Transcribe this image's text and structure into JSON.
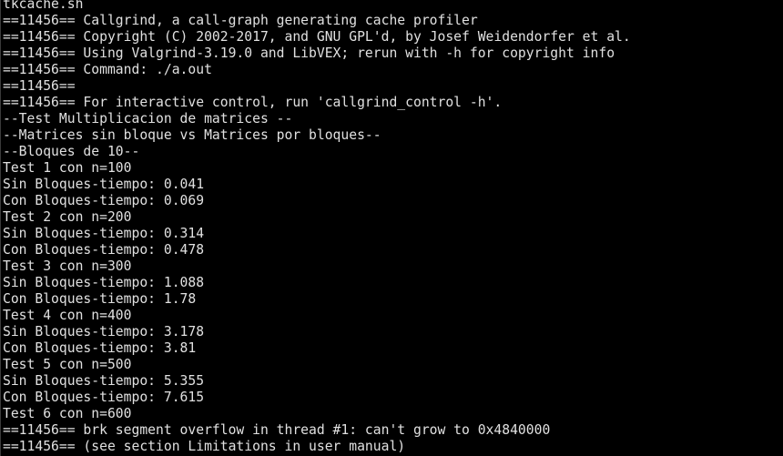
{
  "terminal": {
    "colors": {
      "background": "#000000",
      "foreground": "#e0e0e0"
    },
    "lines": [
      "tkcache.sh",
      "==11456== Callgrind, a call-graph generating cache profiler",
      "==11456== Copyright (C) 2002-2017, and GNU GPL'd, by Josef Weidendorfer et al.",
      "==11456== Using Valgrind-3.19.0 and LibVEX; rerun with -h for copyright info",
      "==11456== Command: ./a.out",
      "==11456==",
      "==11456== For interactive control, run 'callgrind_control -h'.",
      "--Test Multiplicacion de matrices --",
      "--Matrices sin bloque vs Matrices por bloques--",
      "--Bloques de 10--",
      "Test 1 con n=100",
      "Sin Bloques-tiempo: 0.041",
      "Con Bloques-tiempo: 0.069",
      "Test 2 con n=200",
      "Sin Bloques-tiempo: 0.314",
      "Con Bloques-tiempo: 0.478",
      "Test 3 con n=300",
      "Sin Bloques-tiempo: 1.088",
      "Con Bloques-tiempo: 1.78",
      "Test 4 con n=400",
      "Sin Bloques-tiempo: 3.178",
      "Con Bloques-tiempo: 3.81",
      "Test 5 con n=500",
      "Sin Bloques-tiempo: 5.355",
      "Con Bloques-tiempo: 7.615",
      "Test 6 con n=600",
      "==11456== brk segment overflow in thread #1: can't grow to 0x4840000",
      "==11456== (see section Limitations in user manual)"
    ]
  }
}
